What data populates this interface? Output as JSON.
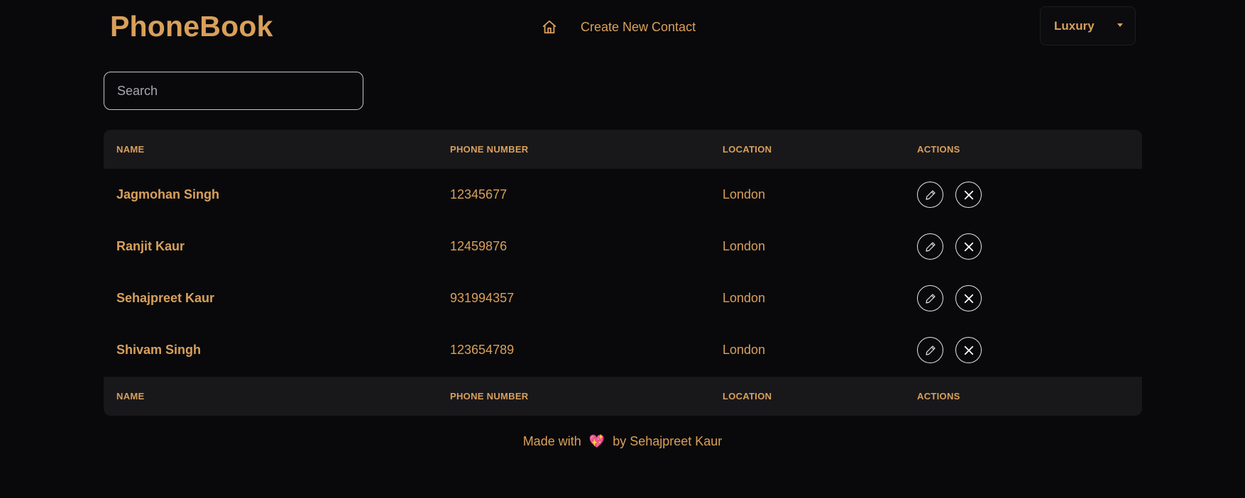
{
  "header": {
    "brand": "PhoneBook",
    "nav": {
      "home_icon": "home-icon",
      "create_label": "Create New Contact"
    },
    "theme_select": {
      "value": "Luxury",
      "icon": "caret-down-icon"
    }
  },
  "search": {
    "placeholder": "Search",
    "value": ""
  },
  "table": {
    "headers": [
      "NAME",
      "PHONE NUMBER",
      "LOCATION",
      "ACTIONS"
    ],
    "footers": [
      "NAME",
      "PHONE NUMBER",
      "LOCATION",
      "ACTIONS"
    ],
    "rows": [
      {
        "name": "Jagmohan Singh",
        "phone": "12345677",
        "location": "London"
      },
      {
        "name": "Ranjit Kaur",
        "phone": "12459876",
        "location": "London"
      },
      {
        "name": "Sehajpreet Kaur",
        "phone": "931994357",
        "location": "London"
      },
      {
        "name": "Shivam Singh",
        "phone": "123654789",
        "location": "London"
      }
    ],
    "action_icons": {
      "edit": "pencil-icon",
      "delete": "close-icon"
    }
  },
  "footer": {
    "prefix": "Made with",
    "heart": "💖",
    "suffix": "by Sehajpreet Kaur"
  },
  "colors": {
    "background": "#09090b",
    "accent": "#d9a05b",
    "header_row": "#18181b"
  }
}
